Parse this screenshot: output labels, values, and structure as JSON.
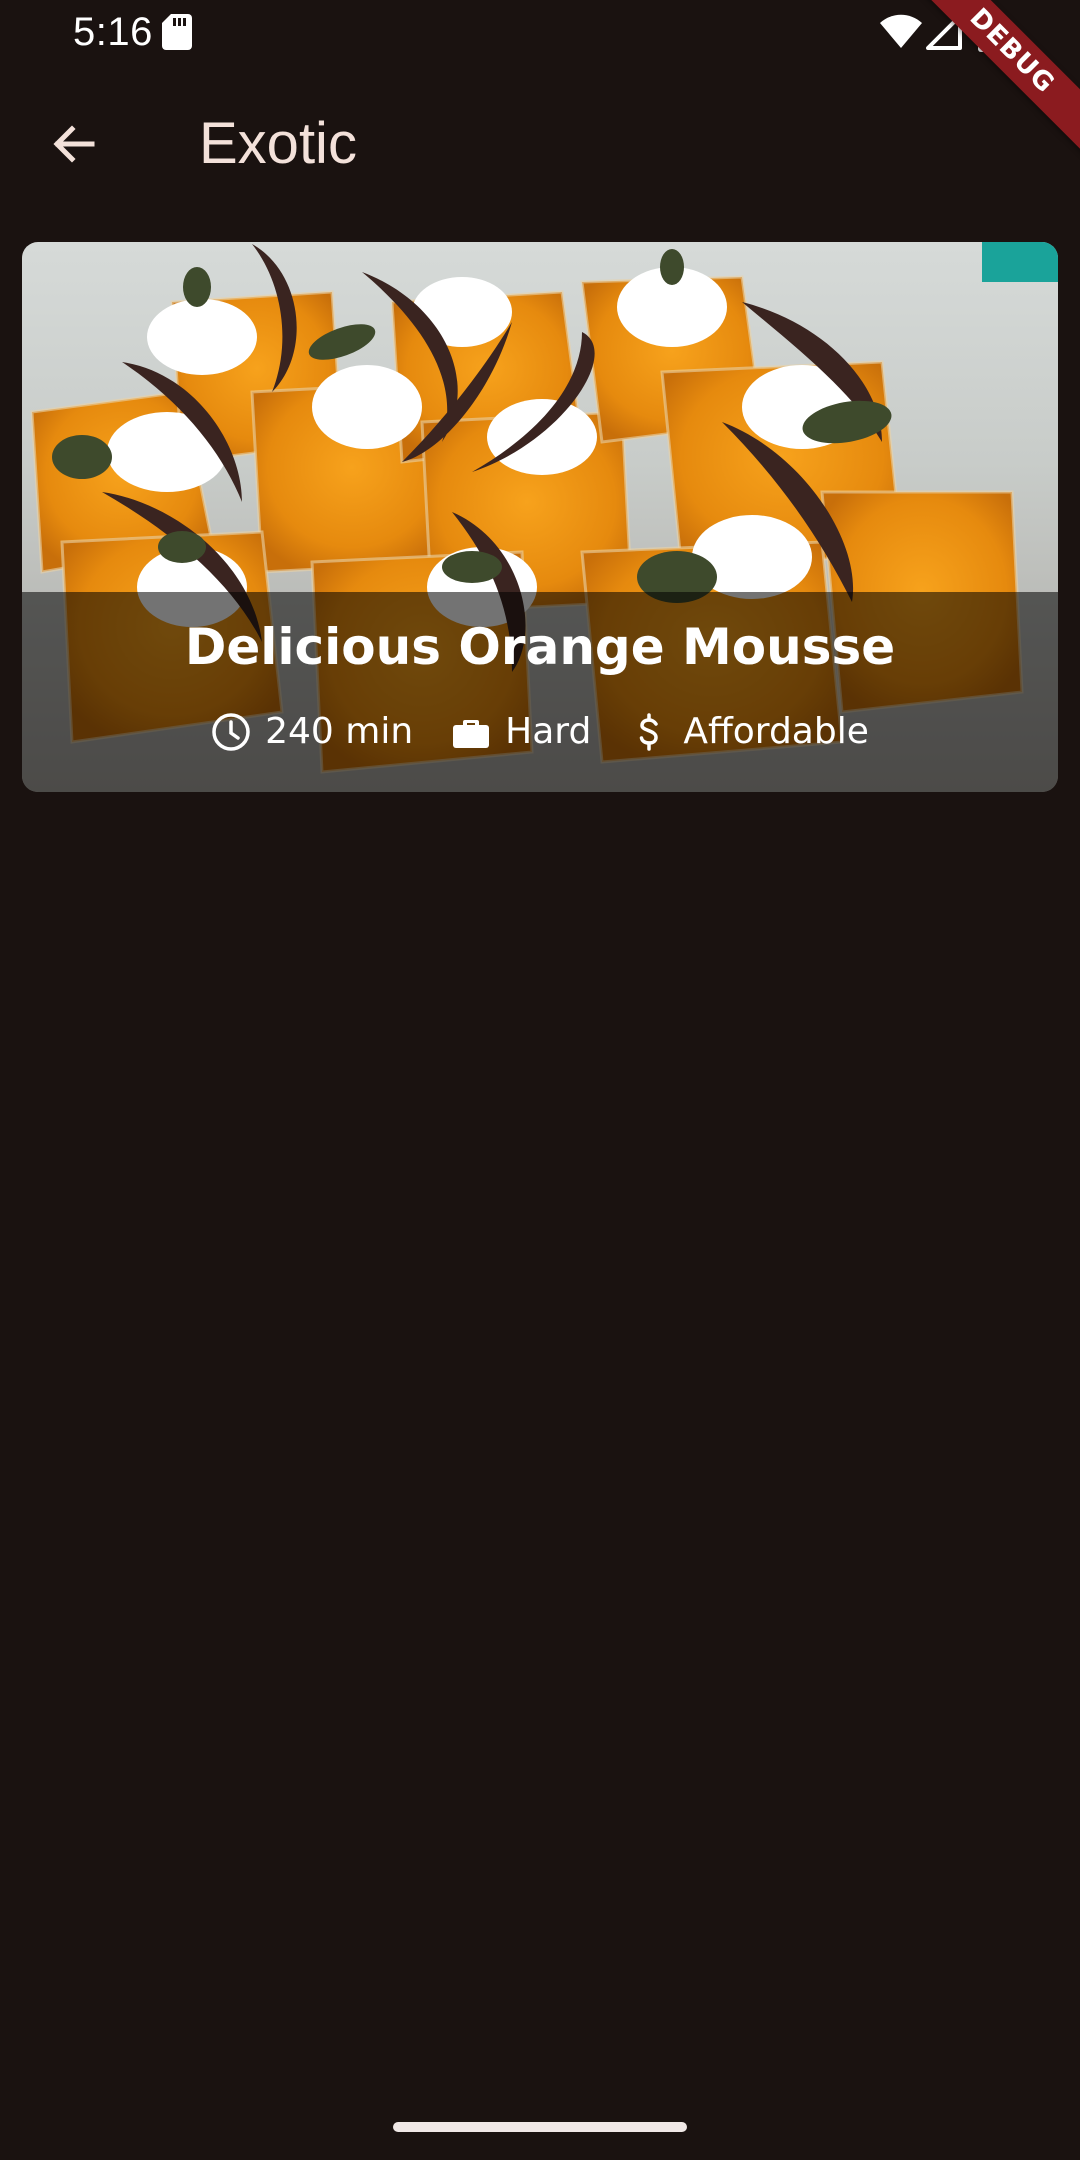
{
  "status_bar": {
    "time": "5:16"
  },
  "debug_banner": {
    "label": "DEBUG",
    "color": "#8b1b1f"
  },
  "app_bar": {
    "title": "Exotic",
    "back_icon": "arrow-back-icon"
  },
  "meals": [
    {
      "title": "Delicious Orange Mousse",
      "duration": "240 min",
      "complexity": "Hard",
      "affordability": "Affordable",
      "icons": {
        "duration": "clock-icon",
        "complexity": "briefcase-icon",
        "affordability": "dollar-icon"
      }
    }
  ],
  "colors": {
    "background": "#1a1210",
    "title_text": "#f3e1da",
    "overlay": "rgba(0,0,0,0.55)"
  }
}
